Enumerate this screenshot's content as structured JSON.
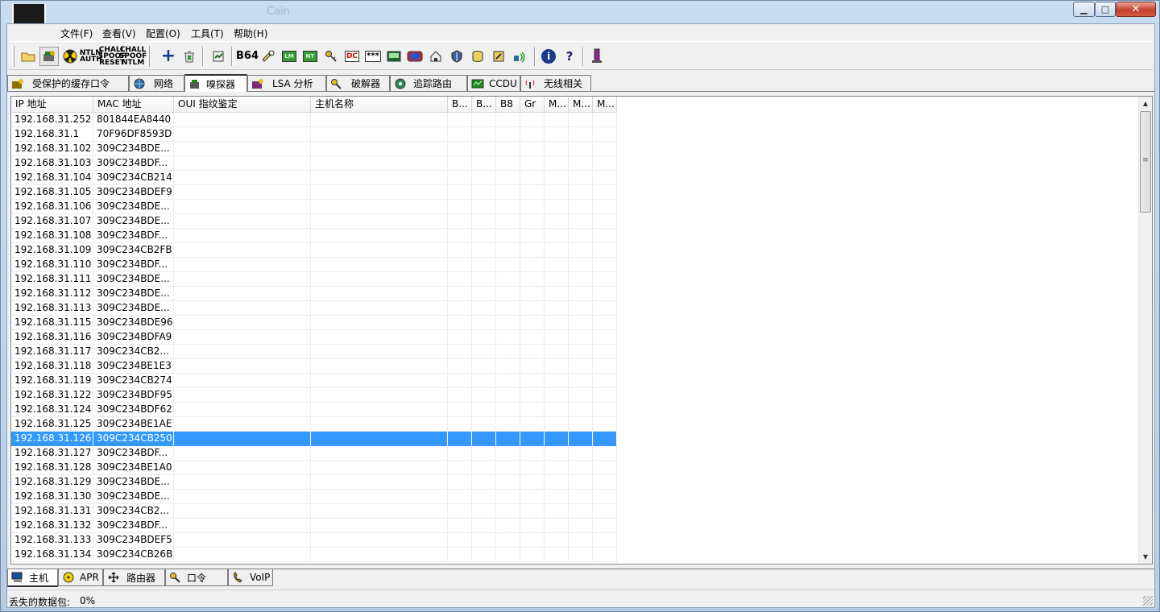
{
  "window": {
    "title": "Cain"
  },
  "caption_buttons": {
    "minimize": "▁",
    "maximize": "□",
    "close": "✕"
  },
  "menu": [
    {
      "label": "文件(F)"
    },
    {
      "label": "查看(V)"
    },
    {
      "label": "配置(O)"
    },
    {
      "label": "工具(T)"
    },
    {
      "label": "帮助(H)"
    }
  ],
  "toolbar": {
    "buttons": [
      {
        "name": "open-icon"
      },
      {
        "name": "sniffer-icon"
      },
      {
        "name": "apr-poison-icon"
      },
      {
        "name": "ntlm-auth-icon",
        "label": "NTLM AUTH"
      },
      {
        "name": "chall-spoof-reset-icon",
        "label": "CHALL SPOOF RESET"
      },
      {
        "name": "chall-spoof-ntlm-icon",
        "label": "CHALL SPOOF NTLM"
      },
      {
        "name": "add-icon",
        "label": "+"
      },
      {
        "name": "remove-icon"
      },
      {
        "name": "report-icon"
      },
      {
        "name": "base64-icon",
        "label": "B64"
      },
      {
        "name": "hash-calc-icon"
      },
      {
        "name": "lm-hash-icon",
        "label": "LM"
      },
      {
        "name": "nt-hash-icon",
        "label": "NT"
      },
      {
        "name": "key-icon"
      },
      {
        "name": "dc-icon",
        "label": "DC"
      },
      {
        "name": "password-box-icon",
        "label": "***"
      },
      {
        "name": "terminal-icon"
      },
      {
        "name": "display-icon"
      },
      {
        "name": "house-icon"
      },
      {
        "name": "shield-icon"
      },
      {
        "name": "db-icon"
      },
      {
        "name": "lock-icon"
      },
      {
        "name": "wireless-icon"
      },
      {
        "name": "info-icon",
        "label": "i"
      },
      {
        "name": "help-icon",
        "label": "?"
      },
      {
        "name": "wizard-icon"
      }
    ]
  },
  "top_tabs": [
    {
      "label": "受保护的缓存口令",
      "icon": "cache-icon",
      "color": "#8b6f00"
    },
    {
      "label": "网络",
      "icon": "globe-icon",
      "color": "#2a6cc4"
    },
    {
      "label": "嗅探器",
      "icon": "sniffer-tab-icon",
      "color": "#333333",
      "active": true
    },
    {
      "label": "LSA 分析",
      "icon": "lsa-icon",
      "color": "#7a2a7a"
    },
    {
      "label": "破解器",
      "icon": "cracker-icon",
      "color": "#c9a000"
    },
    {
      "label": "追踪路由",
      "icon": "traceroute-icon",
      "color": "#2a8a5a"
    },
    {
      "label": "CCDU",
      "icon": "ccdu-icon",
      "color": "#1a8a1a"
    },
    {
      "label": "无线相关",
      "icon": "wireless-tab-icon",
      "color": "#c42a2a"
    }
  ],
  "table": {
    "columns": [
      "IP 地址",
      "MAC 地址",
      "OUI 指纹鉴定",
      "主机名称",
      "B...",
      "B...",
      "B8",
      "Gr",
      "M...",
      "M...",
      "M..."
    ],
    "rows": [
      [
        "192.168.31.252",
        "801844EA8440"
      ],
      [
        "192.168.31.1",
        "70F96DF8593D"
      ],
      [
        "192.168.31.102",
        "309C234BDE..."
      ],
      [
        "192.168.31.103",
        "309C234BDF..."
      ],
      [
        "192.168.31.104",
        "309C234CB214"
      ],
      [
        "192.168.31.105",
        "309C234BDEF9"
      ],
      [
        "192.168.31.106",
        "309C234BDE..."
      ],
      [
        "192.168.31.107",
        "309C234BDE..."
      ],
      [
        "192.168.31.108",
        "309C234BDF..."
      ],
      [
        "192.168.31.109",
        "309C234CB2FB"
      ],
      [
        "192.168.31.110",
        "309C234BDF..."
      ],
      [
        "192.168.31.111",
        "309C234BDE..."
      ],
      [
        "192.168.31.112",
        "309C234BDE..."
      ],
      [
        "192.168.31.113",
        "309C234BDE..."
      ],
      [
        "192.168.31.115",
        "309C234BDE96"
      ],
      [
        "192.168.31.116",
        "309C234BDFA9"
      ],
      [
        "192.168.31.117",
        "309C234CB2..."
      ],
      [
        "192.168.31.118",
        "309C234BE1E3"
      ],
      [
        "192.168.31.119",
        "309C234CB274"
      ],
      [
        "192.168.31.122",
        "309C234BDF95"
      ],
      [
        "192.168.31.124",
        "309C234BDF62"
      ],
      [
        "192.168.31.125",
        "309C234BE1AE"
      ],
      [
        "192.168.31.126",
        "309C234CB250"
      ],
      [
        "192.168.31.127",
        "309C234BDF..."
      ],
      [
        "192.168.31.128",
        "309C234BE1A0"
      ],
      [
        "192.168.31.129",
        "309C234BDE..."
      ],
      [
        "192.168.31.130",
        "309C234BDE..."
      ],
      [
        "192.168.31.131",
        "309C234CB2..."
      ],
      [
        "192.168.31.132",
        "309C234BDF..."
      ],
      [
        "192.168.31.133",
        "309C234BDEF5"
      ],
      [
        "192.168.31.134",
        "309C234CB26B"
      ]
    ],
    "selected_ip": "192.168.31.126",
    "selection_color": "#3399ff"
  },
  "bottom_tabs": [
    {
      "label": "主机",
      "icon": "host-icon",
      "color": "#1d4f9a",
      "active": true
    },
    {
      "label": "APR",
      "icon": "apr-icon",
      "color": "#d4a800"
    },
    {
      "label": "路由器",
      "icon": "router-icon",
      "color": "#333333"
    },
    {
      "label": "口令",
      "icon": "password-icon",
      "color": "#7a5a2a"
    },
    {
      "label": "VoIP",
      "icon": "voip-icon",
      "color": "#c98a00"
    }
  ],
  "status": {
    "label": "丢失的数据包:",
    "value": "0%"
  }
}
